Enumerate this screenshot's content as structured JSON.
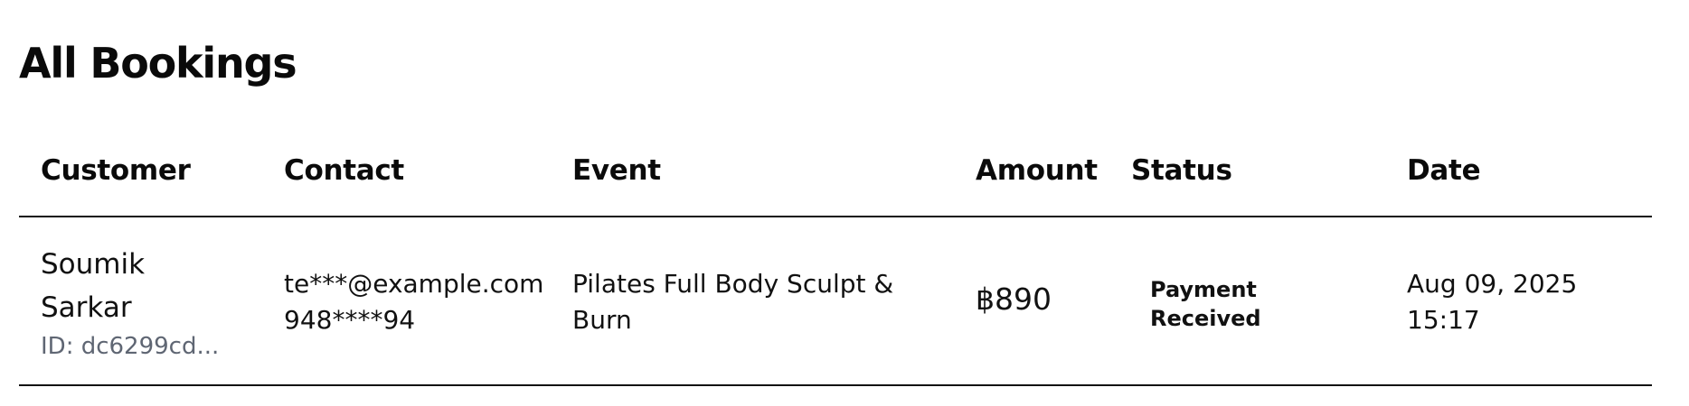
{
  "page": {
    "title": "All Bookings"
  },
  "table": {
    "columns": {
      "customer": "Customer",
      "contact": "Contact",
      "event": "Event",
      "amount": "Amount",
      "status": "Status",
      "date": "Date"
    },
    "rows": [
      {
        "customer_name": "Soumik Sarkar",
        "customer_id": "ID: dc6299cd...",
        "email": "te***@example.com",
        "phone": "948****94",
        "event": "Pilates Full Body Sculpt & Burn",
        "amount": "฿890",
        "status": "Payment Received",
        "date": "Aug 09, 2025",
        "time": "15:17"
      }
    ]
  }
}
